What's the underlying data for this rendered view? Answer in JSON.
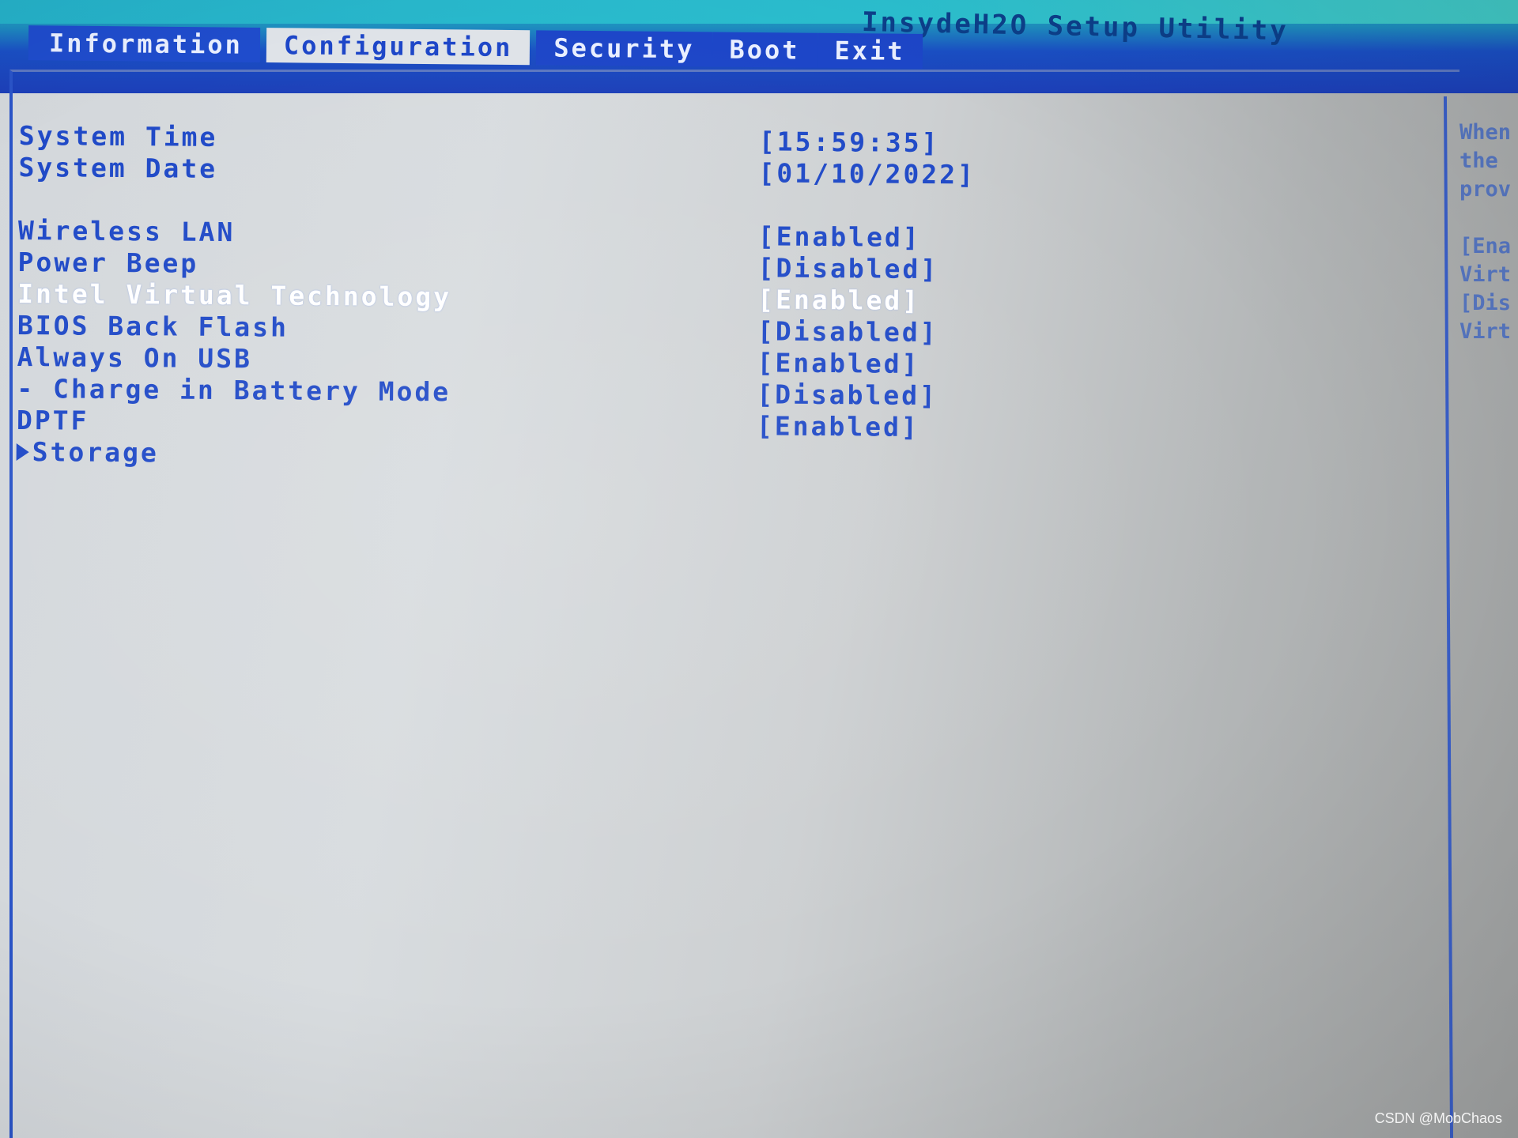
{
  "header": {
    "utility_title": "InsydeH2O Setup Utility",
    "tabs": [
      {
        "label": "Information",
        "active": false
      },
      {
        "label": "Configuration",
        "active": true
      },
      {
        "label": "Security",
        "active": false
      },
      {
        "label": "Boot",
        "active": false
      },
      {
        "label": "Exit",
        "active": false
      }
    ]
  },
  "settings": {
    "system_time": {
      "label": "System Time",
      "value": "[15:59:35]"
    },
    "system_date": {
      "label": "System Date",
      "value": "[01/10/2022]"
    },
    "wireless_lan": {
      "label": "Wireless LAN",
      "value": "[Enabled]"
    },
    "power_beep": {
      "label": "Power Beep",
      "value": "[Disabled]"
    },
    "intel_virtual_technology": {
      "label": "Intel Virtual Technology",
      "value": "[Enabled]",
      "selected": true
    },
    "bios_back_flash": {
      "label": "BIOS Back Flash",
      "value": "[Disabled]"
    },
    "always_on_usb": {
      "label": "Always On USB",
      "value": "[Enabled]"
    },
    "charge_in_battery_mode": {
      "label": "- Charge in Battery Mode",
      "value": "[Disabled]"
    },
    "dptf": {
      "label": "DPTF",
      "value": "[Enabled]"
    },
    "storage": {
      "label": "Storage"
    }
  },
  "help_panel": {
    "lines": [
      "When",
      "the",
      "prov",
      "",
      "[Ena",
      "Virt",
      "[Dis",
      "Virt"
    ]
  },
  "watermark": "CSDN @MobChaos",
  "colors": {
    "bios_blue": "#1f49c7",
    "selected_text": "#ffffff",
    "tab_bar": "#1d46c8",
    "panel_bg": "#d3d7db"
  }
}
